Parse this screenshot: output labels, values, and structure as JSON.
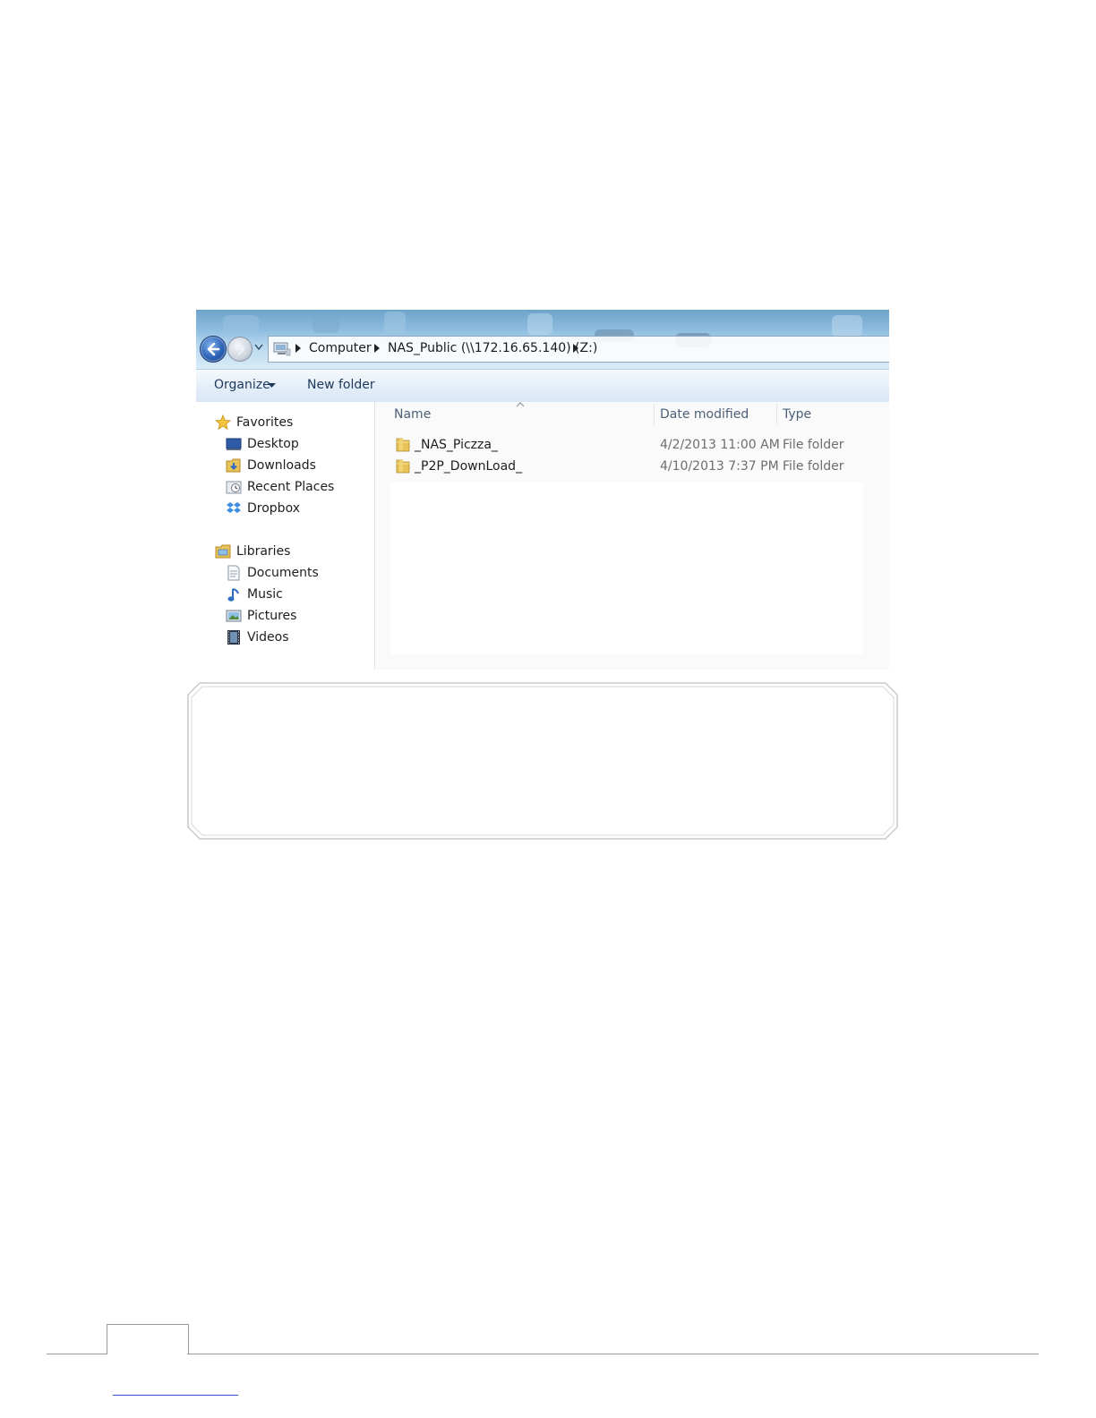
{
  "explorer": {
    "breadcrumb": [
      {
        "label": "Computer"
      },
      {
        "label": "NAS_Public (\\\\172.16.65.140) (Z:)"
      }
    ],
    "toolbar": {
      "organize_label": "Organize",
      "new_folder_label": "New folder"
    },
    "nav": {
      "favorites_label": "Favorites",
      "favorites": [
        {
          "label": "Desktop",
          "icon": "desktop-icon"
        },
        {
          "label": "Downloads",
          "icon": "downloads-icon"
        },
        {
          "label": "Recent Places",
          "icon": "recent-places-icon"
        },
        {
          "label": "Dropbox",
          "icon": "dropbox-icon"
        }
      ],
      "libraries_label": "Libraries",
      "libraries": [
        {
          "label": "Documents",
          "icon": "documents-icon"
        },
        {
          "label": "Music",
          "icon": "music-icon"
        },
        {
          "label": "Pictures",
          "icon": "pictures-icon"
        },
        {
          "label": "Videos",
          "icon": "videos-icon"
        }
      ]
    },
    "columns": {
      "name": "Name",
      "date_modified": "Date modified",
      "type": "Type"
    },
    "files": [
      {
        "name": "_NAS_Piczza_",
        "date": "4/2/2013 11:00 AM",
        "type": "File folder"
      },
      {
        "name": "_P2P_DownLoad_",
        "date": "4/10/2013 7:37 PM",
        "type": "File folder"
      }
    ]
  },
  "colors": {
    "addr_gradient_top": "#6ea3c9",
    "toolbar_text": "#1e395b",
    "column_header_text": "#4c607a",
    "folder_yellow": "#e8c35a",
    "footer_line": "#9a9a9a",
    "footer_link": "#2a4fd0"
  }
}
